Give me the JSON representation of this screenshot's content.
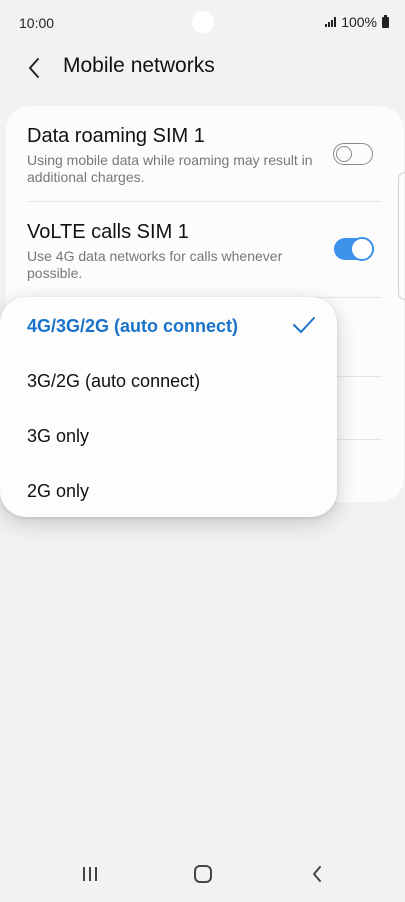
{
  "status_bar": {
    "time": "10:00",
    "battery": "100%"
  },
  "header": {
    "title": "Mobile networks"
  },
  "settings": [
    {
      "title": "Data roaming SIM 1",
      "description": "Using mobile data while roaming may result in additional charges.",
      "toggle": "off"
    },
    {
      "title": "VoLTE calls SIM 1",
      "description": "Use 4G data networks for calls whenever possible.",
      "toggle": "on"
    }
  ],
  "network_mode_menu": {
    "options": [
      "4G/3G/2G (auto connect)",
      "3G/2G (auto connect)",
      "3G only",
      "2G only"
    ],
    "selected": "4G/3G/2G (auto connect)"
  },
  "colors": {
    "accent": "#3e91ea",
    "selected_text": "#1a73c8",
    "background": "#f2f2f2"
  },
  "icons": [
    "back-arrow-icon",
    "signal-icon",
    "battery-icon",
    "check-icon",
    "recent-apps-icon",
    "home-icon",
    "back-icon"
  ]
}
